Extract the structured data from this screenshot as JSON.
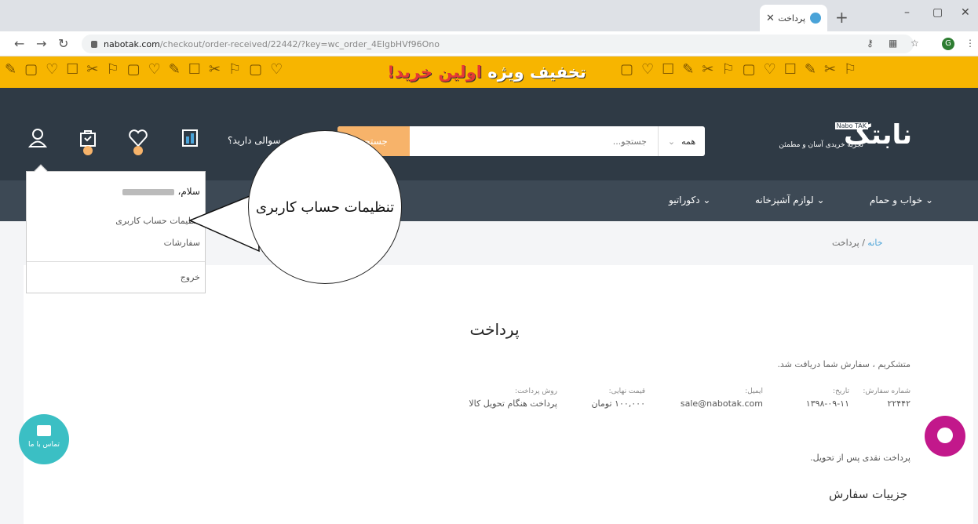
{
  "browser": {
    "tab_title": "پرداخت",
    "url_host": "nabotak.com",
    "url_path": "/checkout/order-received/22442/?key=wc_order_4ElgbHVf96Ono",
    "profile_initial": "G"
  },
  "promo": {
    "text_part1": "تخفیف ویژه",
    "text_part2": "اولین خرید!"
  },
  "header": {
    "logo_text": "نابتک",
    "logo_badge": "Nabo TAK",
    "tagline": "تجربه خریدی آسان و مطمئن",
    "search_category": "همه",
    "search_placeholder": "جستجو...",
    "search_button": "جستجو",
    "question_text": "سوالی دارید؟"
  },
  "nav": {
    "items": [
      {
        "label": "خواب و حمام"
      },
      {
        "label": "لوازم آشپزخانه"
      },
      {
        "label": "دکوراتیو"
      }
    ]
  },
  "breadcrumb": {
    "home": "خانه",
    "separator": "/",
    "current": "پرداخت"
  },
  "user_menu": {
    "greeting": "سلام،",
    "account_settings": "تنظیمات حساب کاربری",
    "orders": "سفارشات",
    "logout": "خروج"
  },
  "callout": {
    "text": "تنظیمات حساب کاربری"
  },
  "page": {
    "title": "پرداخت",
    "thanks": "متشکریم ، سفارش شما دریافت شد.",
    "order": {
      "number_label": "شماره سفارش:",
      "number_value": "۲۲۴۴۲",
      "date_label": "تاریخ:",
      "date_value": "۱۳۹۸-۰۹-۱۱",
      "email_label": "ایمیل:",
      "email_value": "sale@nabotak.com",
      "total_label": "قیمت نهایی:",
      "total_value": "۱۰۰,۰۰۰",
      "total_unit": "تومان",
      "method_label": "روش پرداخت:",
      "method_value": "پرداخت هنگام تحویل کالا"
    },
    "payment_note": "پرداخت نقدی پس از تحویل.",
    "details_title": "جزییات سفارش"
  },
  "chat": {
    "left_label": "تماس با ما"
  },
  "colors": {
    "header_bg": "#2f3a45",
    "nav_bg": "#3d4955",
    "promo_bg": "#f7b500",
    "accent_orange": "#f7b36a",
    "chat_teal": "#3bbfc4",
    "chat_magenta": "#c2188b"
  }
}
